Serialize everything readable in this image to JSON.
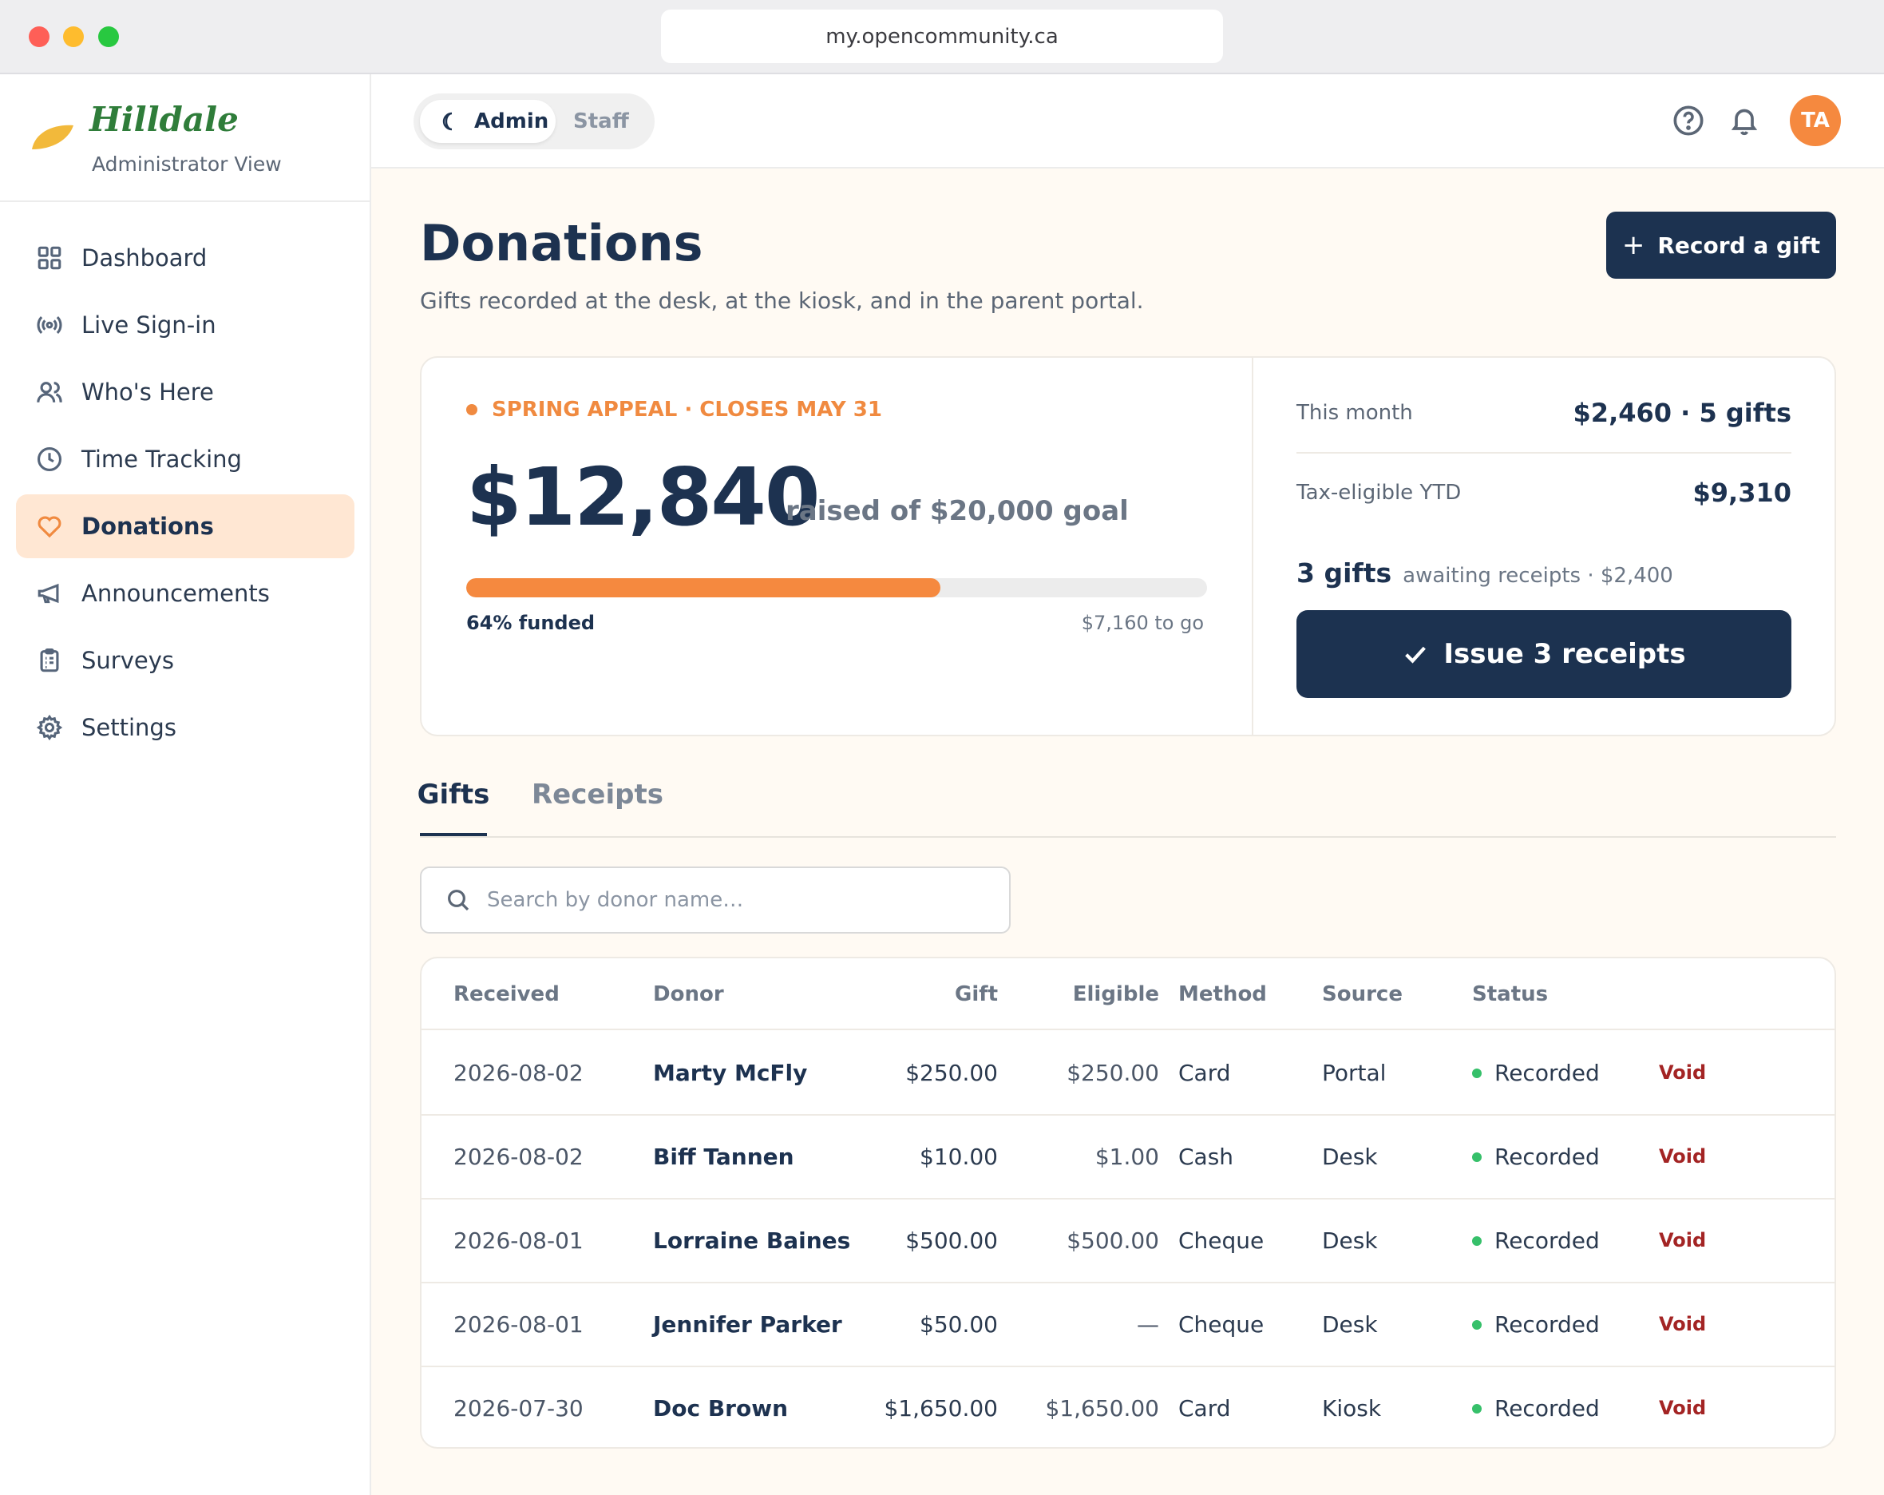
{
  "browser": {
    "url": "my.opencommunity.ca"
  },
  "brand": {
    "name": "Hilldale",
    "subtitle": "Administrator View"
  },
  "sidebar": {
    "items": [
      {
        "label": "Dashboard",
        "icon": "grid-icon",
        "active": false
      },
      {
        "label": "Live Sign-in",
        "icon": "broadcast-icon",
        "active": false
      },
      {
        "label": "Who's Here",
        "icon": "users-icon",
        "active": false
      },
      {
        "label": "Time Tracking",
        "icon": "clock-icon",
        "active": false
      },
      {
        "label": "Donations",
        "icon": "heart-icon",
        "active": true
      },
      {
        "label": "Announcements",
        "icon": "megaphone-icon",
        "active": false
      },
      {
        "label": "Surveys",
        "icon": "clipboard-icon",
        "active": false
      },
      {
        "label": "Settings",
        "icon": "gear-icon",
        "active": false
      }
    ]
  },
  "topbar": {
    "modes": {
      "admin": "Admin",
      "staff": "Staff",
      "selected": "Admin"
    },
    "avatar_initials": "TA"
  },
  "page": {
    "title": "Donations",
    "subtitle": "Gifts recorded at the desk, at the kiosk, and in the parent portal.",
    "record_button": "Record a gift"
  },
  "campaign": {
    "label": "SPRING APPEAL · CLOSES MAY 31",
    "raised": "$12,840",
    "goal_text": "raised of $20,000 goal",
    "progress_percent": 64,
    "funded_text": "64% funded",
    "to_go_text": "$7,160 to go"
  },
  "stats": {
    "this_month_label": "This month",
    "this_month_value": "$2,460 · 5 gifts",
    "tax_label": "Tax-eligible YTD",
    "tax_value": "$9,310",
    "awaiting_count": "3 gifts",
    "awaiting_text": "awaiting receipts · $2,400",
    "issue_button": "Issue 3 receipts"
  },
  "tabs": {
    "gifts": "Gifts",
    "receipts": "Receipts",
    "active": "Gifts"
  },
  "search": {
    "placeholder": "Search by donor name…",
    "value": ""
  },
  "table": {
    "headers": {
      "received": "Received",
      "donor": "Donor",
      "gift": "Gift",
      "eligible": "Eligible",
      "method": "Method",
      "source": "Source",
      "status": "Status"
    },
    "rows": [
      {
        "received": "2026-08-02",
        "donor": "Marty McFly",
        "gift": "$250.00",
        "eligible": "$250.00",
        "method": "Card",
        "source": "Portal",
        "status": "Recorded",
        "action": "Void"
      },
      {
        "received": "2026-08-02",
        "donor": "Biff Tannen",
        "gift": "$10.00",
        "eligible": "$1.00",
        "method": "Cash",
        "source": "Desk",
        "status": "Recorded",
        "action": "Void"
      },
      {
        "received": "2026-08-01",
        "donor": "Lorraine Baines",
        "gift": "$500.00",
        "eligible": "$500.00",
        "method": "Cheque",
        "source": "Desk",
        "status": "Recorded",
        "action": "Void"
      },
      {
        "received": "2026-08-01",
        "donor": "Jennifer Parker",
        "gift": "$50.00",
        "eligible": "—",
        "method": "Cheque",
        "source": "Desk",
        "status": "Recorded",
        "action": "Void"
      },
      {
        "received": "2026-07-30",
        "donor": "Doc Brown",
        "gift": "$1,650.00",
        "eligible": "$1,650.00",
        "method": "Card",
        "source": "Kiosk",
        "status": "Recorded",
        "action": "Void"
      }
    ]
  },
  "colors": {
    "accent": "#f5893f",
    "navy": "#1c3250",
    "brand_green": "#2f7d3a",
    "status_recorded": "#36c06a",
    "void": "#a32424"
  }
}
